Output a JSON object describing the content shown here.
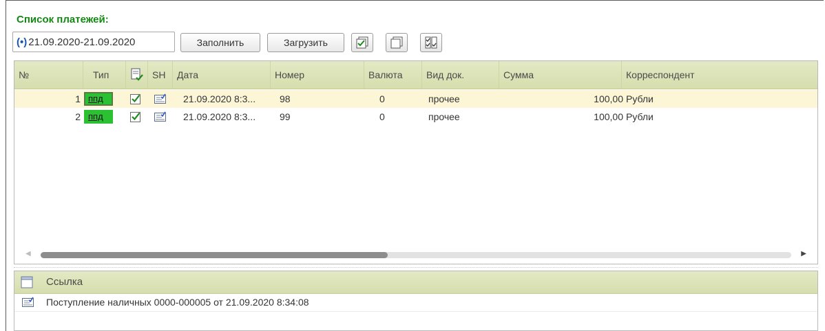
{
  "title": "Список платежей:",
  "toolbar": {
    "period_indicator": "(•)",
    "period": "21.09.2020-21.09.2020",
    "fill_label": "Заполнить",
    "load_label": "Загрузить"
  },
  "table": {
    "headers": {
      "num": "№",
      "tip": "Тип",
      "sh": "SH",
      "date": "Дата",
      "nomer": "Номер",
      "valuta": "Валюта",
      "vid": "Вид док.",
      "summa": "Сумма",
      "korr": "Корреспондент"
    },
    "rows": [
      {
        "num": "1",
        "tip": "ппд",
        "checked": true,
        "date": "21.09.2020 8:3...",
        "nomer": "98",
        "valuta": "0",
        "vid": "прочее",
        "summa": "100,00",
        "korr": "Рубли"
      },
      {
        "num": "2",
        "tip": "ппд",
        "checked": true,
        "date": "21.09.2020 8:3...",
        "nomer": "99",
        "valuta": "0",
        "vid": "прочее",
        "summa": "100,00",
        "korr": "Рубли"
      }
    ],
    "scroll_position": 0
  },
  "reference": {
    "header": "Ссылка",
    "rows": [
      {
        "text": "Поступление наличных 0000-000005 от 21.09.2020 8:34:08"
      }
    ]
  },
  "colors": {
    "title": "#108a10",
    "header_bg": "#dde4ba",
    "selected_row": "#fcf6d7",
    "type_badge": "#2cc133"
  }
}
